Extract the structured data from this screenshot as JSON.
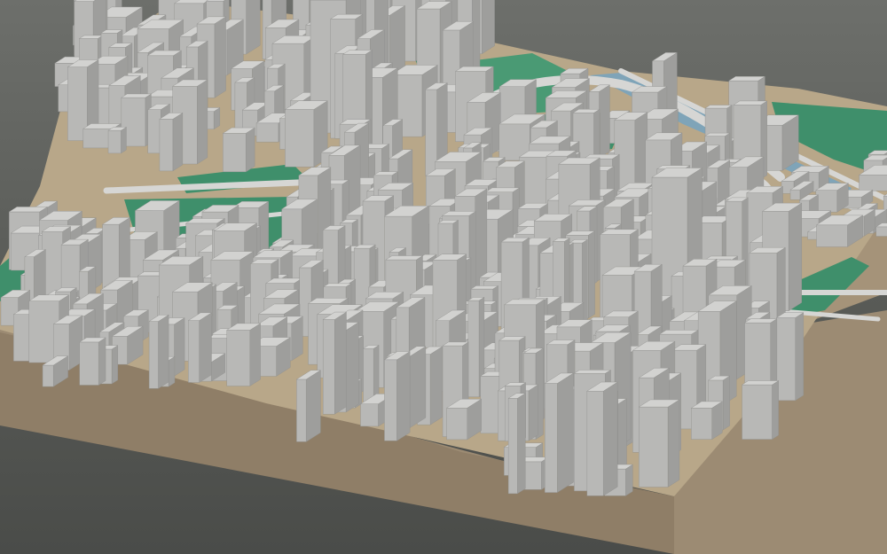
{
  "scene": {
    "subject": "city-terrain-model",
    "colors": {
      "background_top": "#6d6f6b",
      "background_bottom": "#4a4c49",
      "soil": "#a08f77",
      "soil_dark": "#8c7b64",
      "park": "#3f8f6b",
      "park_dark": "#2f7657",
      "water": "#7fa4b8",
      "road": "#cfcfcd",
      "building_light": "#d2d2d0",
      "building_mid": "#b8b8b6",
      "building_dark": "#9e9e9c",
      "sand": "#c9b89a"
    }
  }
}
